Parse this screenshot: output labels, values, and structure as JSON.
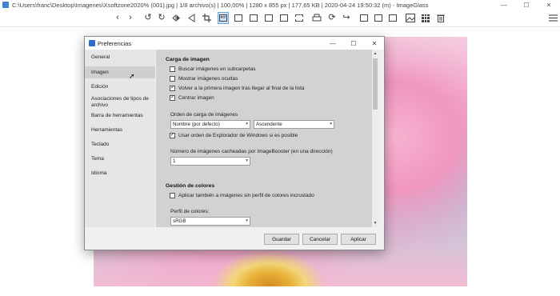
{
  "window": {
    "title": "C:\\Users\\franc\\Desktop\\Imagenes\\Xsoftzone2020% (001).jpg  |  1/8 archivo(s)  |  100,00%  |  1280 x 855 px  |  177,65 KB  |  2020-04-24 19:50:32 (m)  -  ImageGlass",
    "minimize": "—",
    "maximize": "☐",
    "close": "✕"
  },
  "toolbar": {
    "prev_icon": "‹",
    "next_icon": "›",
    "rotate_left_icon": "↺",
    "rotate_right_icon": "↻",
    "fit_label": "FIT"
  },
  "dialog": {
    "title": "Preferencias",
    "minimize": "—",
    "maximize": "☐",
    "close": "✕",
    "nav": [
      "General",
      "Imagen",
      "Edición",
      "Asociaciones de tipos de archivo",
      "Barra de herramientas",
      "Herramientas",
      "Teclado",
      "Tema",
      "Idioma"
    ],
    "content": {
      "section_load": "Carga de imagen",
      "cb_subfolders": "Buscar imágenes en subcarpetas",
      "cb_hidden": "Mostrar imágenes ocultas",
      "cb_loop": "Volver a la primera imagen tras llegar al final de la lista",
      "cb_center": "Centrar imagen",
      "order_label": "Orden de carga de imágenes",
      "order_value": "Nombre (por defecto)",
      "direction_value": "Ascendente",
      "cb_explorer": "Usar orden de Explorador de Windows si es posible",
      "cache_label": "Número de imágenes cacheadas por ImageBooster (en una dirección)",
      "cache_value": "1",
      "section_color": "Gestión de colores",
      "cb_embedded": "Aplicar también a imágenes sin perfil de colores incrustado",
      "profile_label": "Perfil de colores:",
      "profile_value": "sRGB"
    },
    "checked": {
      "subfolders": false,
      "hidden": false,
      "loop": true,
      "center": true,
      "explorer": true,
      "embedded": false
    },
    "buttons": {
      "save": "Guardar",
      "cancel": "Cancelar",
      "apply": "Aplicar"
    }
  }
}
